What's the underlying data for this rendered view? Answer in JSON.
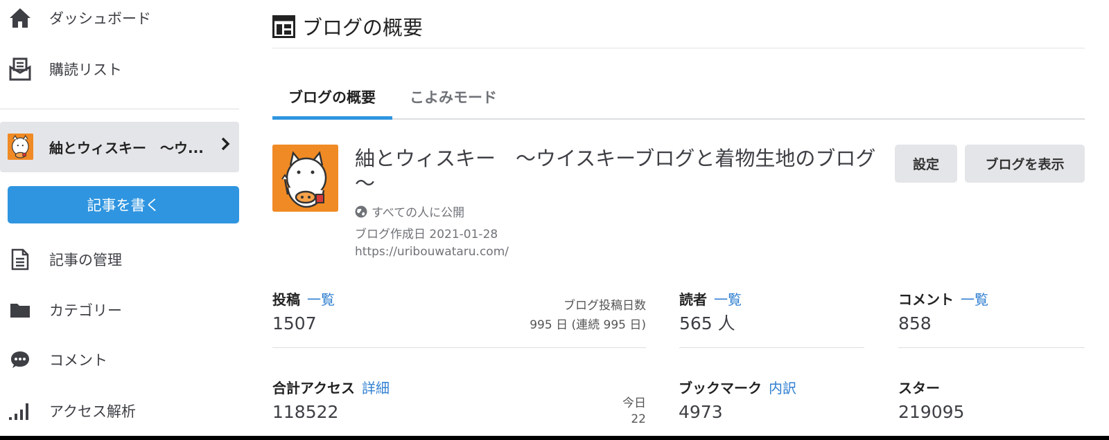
{
  "sidebar": {
    "items_top": [
      {
        "label": "ダッシュボード",
        "icon": "home-icon"
      },
      {
        "label": "購読リスト",
        "icon": "subscription-icon"
      }
    ],
    "blog": {
      "name": "紬とウィスキー　～ウ...",
      "chevron": "›"
    },
    "write_button": "記事を書く",
    "items_bottom": [
      {
        "label": "記事の管理",
        "icon": "document-icon"
      },
      {
        "label": "カテゴリー",
        "icon": "folder-icon"
      },
      {
        "label": "コメント",
        "icon": "comment-icon"
      },
      {
        "label": "アクセス解析",
        "icon": "bar-chart-icon"
      }
    ]
  },
  "main": {
    "page_title": "ブログの概要",
    "tabs": [
      {
        "label": "ブログの概要",
        "active": true
      },
      {
        "label": "こよみモード",
        "active": false
      }
    ],
    "blog": {
      "title": "紬とウィスキー　～ウイスキーブログと着物生地のブログ～",
      "visibility": "すべての人に公開",
      "created": "ブログ作成日 2021-01-28",
      "url": "https://uribouwataru.com/"
    },
    "buttons": {
      "settings": "設定",
      "view_blog": "ブログを表示"
    },
    "stats": {
      "posts": {
        "label": "投稿",
        "link": "一覧",
        "value": "1507",
        "side_label": "ブログ投稿日数",
        "side_value": "995 日 (連続 995 日)"
      },
      "readers": {
        "label": "読者",
        "link": "一覧",
        "value": "565 人"
      },
      "comments": {
        "label": "コメント",
        "link": "一覧",
        "value": "858"
      },
      "access": {
        "label": "合計アクセス",
        "link": "詳細",
        "value": "118522",
        "side_label": "今日",
        "side_value": "22"
      },
      "bookmarks": {
        "label": "ブックマーク",
        "link": "内訳",
        "value": "4973"
      },
      "stars": {
        "label": "スター",
        "value": "219095"
      }
    }
  },
  "colors": {
    "accent": "#2f95e0",
    "link": "#2f7fd1",
    "avatar_bg": "#f08a24",
    "button_bg": "#e4e5e8"
  }
}
